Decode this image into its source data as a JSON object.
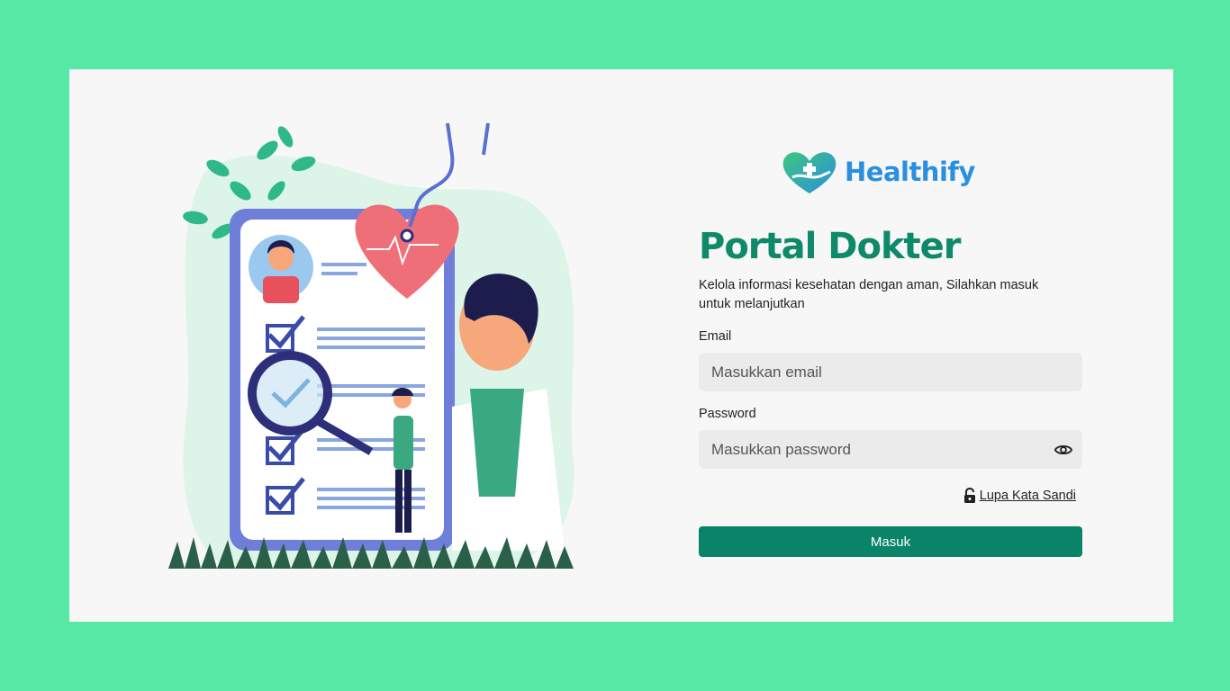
{
  "brand": {
    "name": "Healthify",
    "color": "#2a8fe0"
  },
  "login": {
    "title": "Portal Dokter",
    "subtitle": "Kelola informasi kesehatan dengan aman, Silahkan masuk untuk melanjutkan",
    "email_label": "Email",
    "email_placeholder": "Masukkan email",
    "email_value": "",
    "password_label": "Password",
    "password_placeholder": "Masukkan password",
    "password_value": "",
    "forgot_label": "Lupa Kata Sandi",
    "submit_label": "Masuk"
  },
  "icons": {
    "logo": "heart-hand-logo-icon",
    "eye": "eye-icon",
    "lock": "unlock-icon"
  },
  "colors": {
    "background": "#58e8a5",
    "card": "#f7f7f7",
    "accent": "#0a8468",
    "title": "#0e8a6a"
  }
}
